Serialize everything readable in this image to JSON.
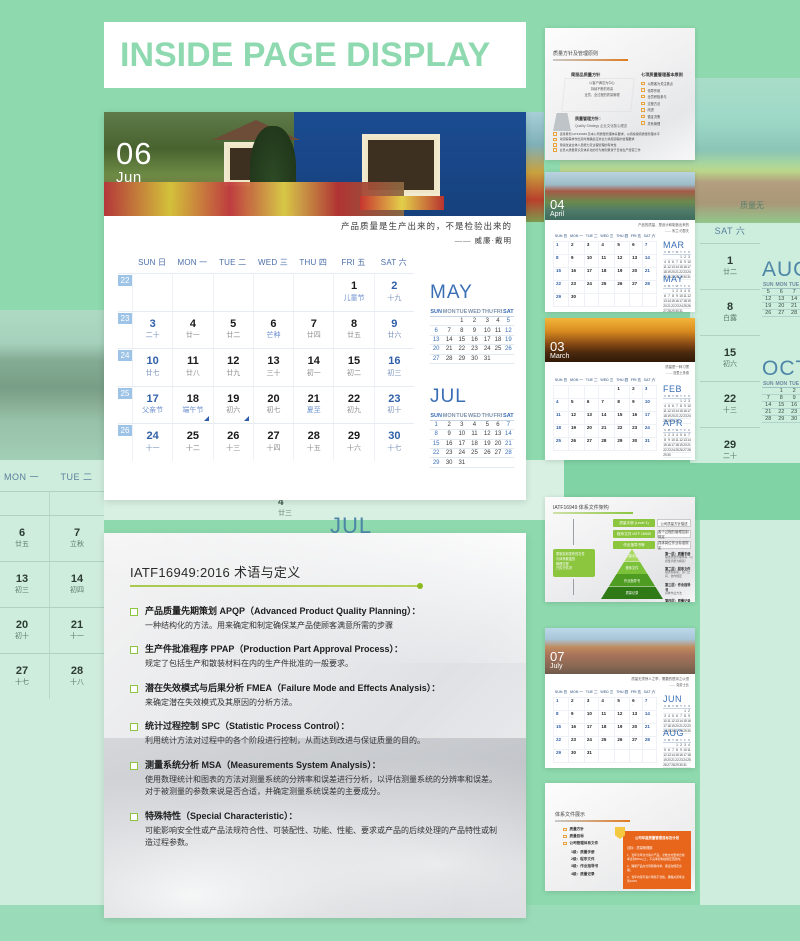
{
  "page": {
    "title": "INSIDE PAGE DISPLAY",
    "background_color": "#8ed9ae",
    "accent_green": "#8fd9b0",
    "accent_blue": "#2f5fa8"
  },
  "main_calendar": {
    "month_number": "06",
    "month_name": "Jun",
    "quote_line1": "产品质量是生产出来的，不是检验出来的",
    "quote_line2": "—— 威廉·戴明",
    "weekday_headers": [
      "SUN 日",
      "MON 一",
      "TUE 二",
      "WED 三",
      "THU 四",
      "FRI 五",
      "SAT 六"
    ],
    "week_numbers": [
      "22",
      "23",
      "24",
      "25",
      "26"
    ],
    "weeks": [
      [
        {
          "n": "",
          "l": ""
        },
        {
          "n": "",
          "l": ""
        },
        {
          "n": "",
          "l": ""
        },
        {
          "n": "",
          "l": ""
        },
        {
          "n": "",
          "l": ""
        },
        {
          "n": "1",
          "l": "儿童节",
          "fest": true
        },
        {
          "n": "2",
          "l": "十九",
          "we": true
        }
      ],
      [
        {
          "n": "3",
          "l": "二十",
          "we": true
        },
        {
          "n": "4",
          "l": "廿一"
        },
        {
          "n": "5",
          "l": "廿二"
        },
        {
          "n": "6",
          "l": "芒种",
          "fest": true
        },
        {
          "n": "7",
          "l": "廿四"
        },
        {
          "n": "8",
          "l": "廿五"
        },
        {
          "n": "9",
          "l": "廿六",
          "we": true
        }
      ],
      [
        {
          "n": "10",
          "l": "廿七",
          "we": true
        },
        {
          "n": "11",
          "l": "廿八"
        },
        {
          "n": "12",
          "l": "廿九"
        },
        {
          "n": "13",
          "l": "三十"
        },
        {
          "n": "14",
          "l": "初一"
        },
        {
          "n": "15",
          "l": "初二"
        },
        {
          "n": "16",
          "l": "初三",
          "we": true
        }
      ],
      [
        {
          "n": "17",
          "l": "父亲节",
          "we": true,
          "fest": true
        },
        {
          "n": "18",
          "l": "端午节",
          "fest": true,
          "corner": true
        },
        {
          "n": "19",
          "l": "初六",
          "corner": true
        },
        {
          "n": "20",
          "l": "初七"
        },
        {
          "n": "21",
          "l": "夏至",
          "fest": true
        },
        {
          "n": "22",
          "l": "初九"
        },
        {
          "n": "23",
          "l": "初十",
          "we": true
        }
      ],
      [
        {
          "n": "24",
          "l": "十一",
          "we": true
        },
        {
          "n": "25",
          "l": "十二"
        },
        {
          "n": "26",
          "l": "十三"
        },
        {
          "n": "27",
          "l": "十四"
        },
        {
          "n": "28",
          "l": "十五"
        },
        {
          "n": "29",
          "l": "十六"
        },
        {
          "n": "30",
          "l": "十七",
          "we": true
        }
      ]
    ],
    "mini_headers": [
      "SUN",
      "MON",
      "TUE",
      "WED",
      "THU",
      "FRI",
      "SAT"
    ],
    "mini_months": [
      {
        "label": "MAY",
        "weeks": [
          [
            "",
            "",
            "1",
            "2",
            "3",
            "4",
            "5"
          ],
          [
            "6",
            "7",
            "8",
            "9",
            "10",
            "11",
            "12"
          ],
          [
            "13",
            "14",
            "15",
            "16",
            "17",
            "18",
            "19"
          ],
          [
            "20",
            "21",
            "22",
            "23",
            "24",
            "25",
            "26"
          ],
          [
            "27",
            "28",
            "29",
            "30",
            "31",
            "",
            ""
          ]
        ]
      },
      {
        "label": "JUL",
        "weeks": [
          [
            "1",
            "2",
            "3",
            "4",
            "5",
            "6",
            "7"
          ],
          [
            "8",
            "9",
            "10",
            "11",
            "12",
            "13",
            "14"
          ],
          [
            "15",
            "16",
            "17",
            "18",
            "19",
            "20",
            "21"
          ],
          [
            "22",
            "23",
            "24",
            "25",
            "26",
            "27",
            "28"
          ],
          [
            "29",
            "30",
            "31",
            "",
            "",
            "",
            ""
          ]
        ]
      }
    ]
  },
  "doc_card": {
    "title": "IATF16949:2016 术语与定义",
    "terms": [
      {
        "heading": "产品质量先期策划 APQP（Advanced Product Quality Planning）：",
        "body": "一种结构化的方法。用来确定和制定确保某产品使顾客满意所需的步骤"
      },
      {
        "heading": "生产件批准程序 PPAP（Production Part Approval Process）：",
        "body": "规定了包括生产和散装材料在内的生产件批准的一般要求。"
      },
      {
        "heading": "潜在失效模式与后果分析 FMEA（Failure Mode and Effects Analysis）：",
        "body": "来确定潜在失效模式及其原因的分析方法。"
      },
      {
        "heading": "统计过程控制 SPC（Statistic Process Control）：",
        "body": "利用统计方法对过程中的各个阶段进行控制，从而达到改进与保证质量的目的。"
      },
      {
        "heading": "测量系统分析 MSA（Measurements System Analysis）：",
        "body": "使用数理统计和图表的方法对测量系统的分辨率和误差进行分析，以评估测量系统的分辨率和误差。对于被测量的参数来说是否合适，并确定测量系统误差的主要成分。"
      },
      {
        "heading": "特殊特性（Special Characteristic）：",
        "body": "可能影响安全性或产品法规符合性、可装配性、功能、性能、要求或产品的后续处理的产品特性或制造过程参数。"
      }
    ]
  },
  "thumbnails": [
    {
      "name": "policy-slide",
      "type": "slide",
      "title": "质量方针及管理原则",
      "left_heading": "简丽品质量方针",
      "left_lines": [
        "以客户满意为中心",
        "持续不断的改善",
        "全员、全过程的质量管理"
      ],
      "right_heading": "七项质量管理基本原则",
      "right_items": [
        "以顾客为关注焦点",
        "领导作用",
        "全员积极参与",
        "过程方法",
        "改进",
        "循证决策",
        "关系管理"
      ],
      "footer_heading": "质量管理方针：",
      "footer_sub": "Quality Strategy 企业文化核心理念",
      "footer_items": [
        "坚持贯彻 IATF16949 及本公司质量管理体系要求，以持续保持质量管理水平",
        "对顾客需求作出及时准确反应并全力满足顾客的合理要求",
        "持续改进全体人员能力及过程管理的有效性",
        "全员以质量意识及体系化的行为准则贯穿于日常生产经营工作"
      ]
    },
    {
      "name": "april-calendar",
      "type": "calendar",
      "month_number": "04",
      "month_name": "April",
      "quote": "产品的质量，是设计和制造出来的",
      "quote_by": "—— 朱兰·约瑟夫",
      "mini_months": [
        "MAR",
        "MAY"
      ]
    },
    {
      "name": "march-calendar",
      "type": "calendar",
      "month_number": "03",
      "month_name": "March",
      "quote": "质量是一种习惯",
      "quote_by": "—— 亚里士多德",
      "mini_months": [
        "FEB",
        "APR"
      ]
    },
    {
      "name": "pyramid-slide",
      "type": "slide",
      "title": "IATF16949 体系文件架构",
      "top_boxes": [
        {
          "label": "质量手册 (Level 1)",
          "note": "公司质量方针描述"
        },
        {
          "label": "程序文件 IATF 16949",
          "note": "各个过程的管理控制规定"
        },
        {
          "label": "作业指导书等",
          "note": "具体岗位作业标准规定"
        }
      ],
      "left_note_lines": [
        "需制定和发布的文件",
        "与体系覆盖的",
        "管理过程",
        "已执行情况"
      ],
      "pyramid_levels": [
        "质量手册",
        "程序文件",
        "作业指导书",
        "质量记录"
      ],
      "right_notes": [
        {
          "title": "第一层：质量手册",
          "body": "描述质量管理体系（以质量手册为纲领）"
        },
        {
          "title": "第二层：程序文件",
          "body": "描述各职能、部门之间、协作规定"
        },
        {
          "title": "第三层：作业指导书",
          "body": "具体作业方法"
        },
        {
          "title": "第四层：质量记录",
          "body": "提供符合性的客观证据，用于追溯"
        }
      ]
    },
    {
      "name": "july-calendar",
      "type": "calendar",
      "month_number": "07",
      "month_name": "July",
      "quote": "质量无须惊人之举，需要的是持之以恒",
      "quote_by": "—— 克劳士比",
      "mini_months": [
        "JUN",
        "AUG"
      ]
    },
    {
      "name": "document-structure-slide",
      "type": "slide",
      "title": "体系文件展示",
      "bullets": [
        "质量方针",
        "质量目标",
        "公司管理体系文件"
      ],
      "numbered": [
        "1级：质量手册",
        "2级：程序文件",
        "3级：作业指导书",
        "4级：质量记录"
      ],
      "panel_title": "公司年度质量管理目标及计划",
      "panel_sub": "目标：质量管理部",
      "panel_lines": [
        "1、当年全年交付客户产品，全数交付要求合格率达到99%以上，不良率控制在规定范围内；",
        "2、确保产品交付周期准时率，保证在规定交期；",
        "3、当年内部与客户审核不合格，确保关闭率达到100%"
      ]
    }
  ],
  "background": {
    "left_calendar": {
      "weekday_headers": [
        "MON 一",
        "TUE 二"
      ],
      "rows": [
        [
          {
            "n": "",
            "l": ""
          },
          {
            "n": "",
            "l": ""
          }
        ],
        [
          {
            "n": "6",
            "l": "廿五"
          },
          {
            "n": "7",
            "l": "立秋"
          }
        ],
        [
          {
            "n": "13",
            "l": "初三"
          },
          {
            "n": "14",
            "l": "初四"
          }
        ],
        [
          {
            "n": "20",
            "l": "初十"
          },
          {
            "n": "21",
            "l": "十一"
          }
        ],
        [
          {
            "n": "27",
            "l": "十七"
          },
          {
            "n": "28",
            "l": "十八"
          }
        ]
      ],
      "mini_title": "JUL"
    },
    "right_calendar": {
      "weekday_header": "SAT 六",
      "rows": [
        {
          "n": "1",
          "l": "廿二"
        },
        {
          "n": "8",
          "l": "白露"
        },
        {
          "n": "15",
          "l": "初六"
        },
        {
          "n": "22",
          "l": "十三"
        },
        {
          "n": "29",
          "l": "二十"
        }
      ],
      "mini_titles": [
        "AUG",
        "OCT"
      ],
      "mini_headers": [
        "SUN",
        "MON",
        "TUE"
      ],
      "aug_weeks": [
        [
          "5",
          "6",
          "7"
        ],
        [
          "12",
          "13",
          "14"
        ],
        [
          "19",
          "20",
          "21"
        ],
        [
          "26",
          "27",
          "28"
        ]
      ],
      "oct_weeks": [
        [
          "",
          "1",
          "2"
        ],
        [
          "7",
          "8",
          "9"
        ],
        [
          "14",
          "15",
          "16"
        ],
        [
          "21",
          "22",
          "23"
        ],
        [
          "28",
          "29",
          "30"
        ]
      ]
    },
    "top_right_quote": "质量无",
    "mid_weekday_headers": [
      "MON 一",
      "TUE 二"
    ]
  }
}
